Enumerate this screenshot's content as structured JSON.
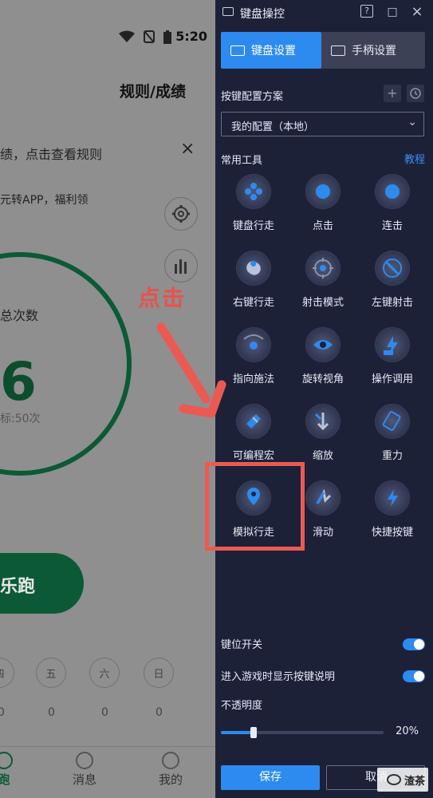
{
  "phone": {
    "status_time": "5:20",
    "page_title": "规则/成绩",
    "tip_text": "绩，点击查看规则",
    "promo_text": "元转APP，福利领",
    "count_label": "总次数",
    "count_value": "6",
    "count_target": "标:50次",
    "run_button": "乐跑",
    "weekdays": [
      "四",
      "五",
      "六",
      "日"
    ],
    "day_counts": [
      "0",
      "0",
      "0",
      "0"
    ],
    "nav": [
      "跑",
      "消息",
      "我的"
    ]
  },
  "panel": {
    "title": "键盘操控",
    "titlebar_buttons": [
      "?",
      "□",
      "×"
    ],
    "tabs": [
      {
        "label": "键盘设置",
        "active": true
      },
      {
        "label": "手柄设置",
        "active": false
      }
    ],
    "scheme_label": "按键配置方案",
    "scheme_value": "我的配置（本地）",
    "tools_label": "常用工具",
    "tutorial_link": "教程",
    "tools": [
      {
        "label": "键盘行走",
        "icon": "dpad-icon"
      },
      {
        "label": "点击",
        "icon": "tap-icon"
      },
      {
        "label": "连击",
        "icon": "multi-tap-icon"
      },
      {
        "label": "右键行走",
        "icon": "mouse-icon"
      },
      {
        "label": "射击模式",
        "icon": "crosshair-icon"
      },
      {
        "label": "左键射击",
        "icon": "left-shoot-icon"
      },
      {
        "label": "指向施法",
        "icon": "aim-cast-icon"
      },
      {
        "label": "旋转视角",
        "icon": "eye-icon"
      },
      {
        "label": "操作调用",
        "icon": "record-icon"
      },
      {
        "label": "可编程宏",
        "icon": "macro-icon"
      },
      {
        "label": "缩放",
        "icon": "zoom-icon"
      },
      {
        "label": "重力",
        "icon": "gravity-icon"
      },
      {
        "label": "模拟行走",
        "icon": "location-pin-icon"
      },
      {
        "label": "滑动",
        "icon": "swipe-icon"
      },
      {
        "label": "快捷按键",
        "icon": "lightning-icon"
      }
    ],
    "toggles": [
      {
        "label": "键位开关",
        "on": true
      },
      {
        "label": "进入游戏时显示按键说明",
        "on": true
      }
    ],
    "opacity_label": "不透明度",
    "opacity_value": "20%",
    "opacity_level": 0.2,
    "save_button": "保存",
    "cancel_button": "取消"
  },
  "annotation": {
    "text": "点击",
    "color": "#ea5a53"
  },
  "watermark": "渣茶",
  "colors": {
    "accent": "#2d8bf0",
    "panel_bg": "#1d2138",
    "phone_green": "#0b5a35"
  }
}
